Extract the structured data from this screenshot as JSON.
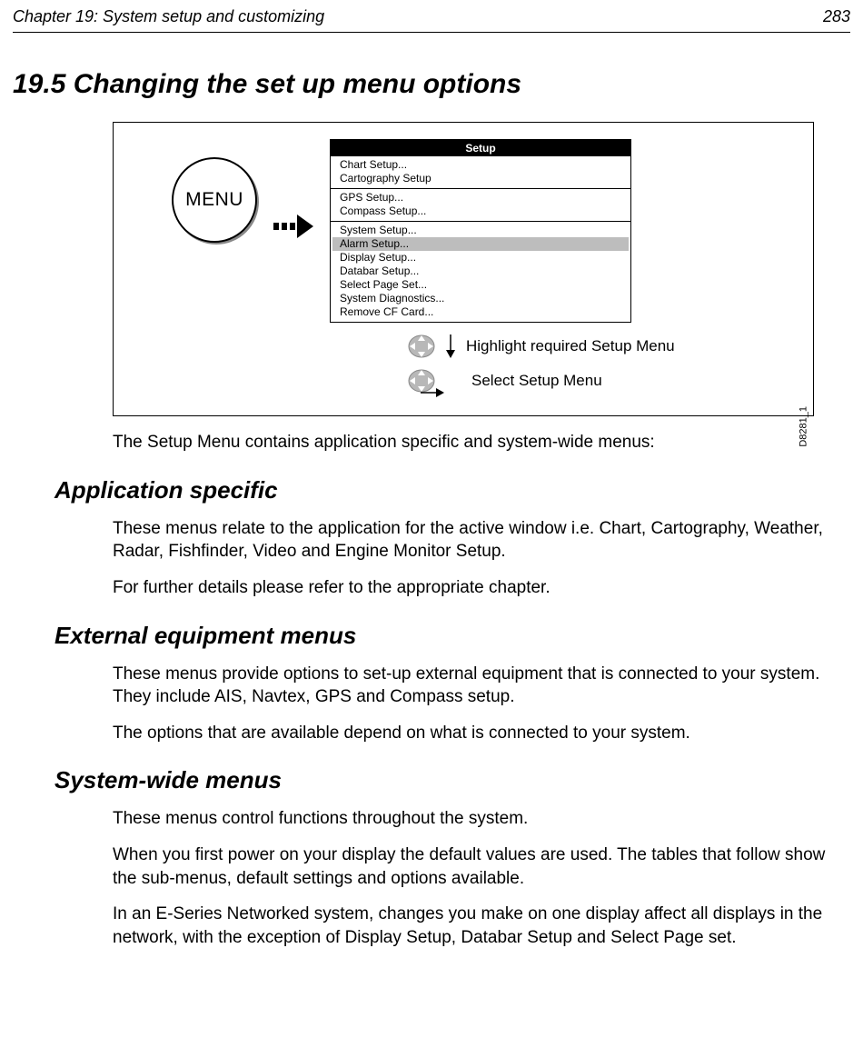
{
  "header": {
    "chapter": "Chapter 19: System setup and customizing",
    "page": "283"
  },
  "section_title": "19.5 Changing the set up menu options",
  "figure": {
    "menu_button": "MENU",
    "setup_title": "Setup",
    "groups": [
      [
        "Chart Setup...",
        "Cartography Setup"
      ],
      [
        "GPS Setup...",
        "Compass Setup..."
      ],
      [
        "System Setup...",
        "Alarm Setup...",
        "Display Setup...",
        "Databar Setup...",
        "Select Page Set...",
        "System Diagnostics...",
        "Remove CF Card..."
      ]
    ],
    "highlight": "Alarm Setup...",
    "hint1": "Highlight required Setup Menu",
    "hint2": "Select Setup Menu",
    "fig_id": "D8281_1"
  },
  "intro": "The Setup Menu contains application specific and system-wide menus:",
  "app_heading": "Application specific",
  "app_p1": "These menus relate to the application for the active window i.e. Chart, Cartography, Weather, Radar, Fishfinder, Video and Engine Monitor Setup.",
  "app_p2": "For further details please refer to the appropriate chapter.",
  "ext_heading": "External equipment menus",
  "ext_p1": "These menus provide options to set-up external equipment that is connected to your system. They include AIS, Navtex, GPS and Compass setup.",
  "ext_p2": "The options that are available depend on what is connected to your system.",
  "sys_heading": "System-wide menus",
  "sys_p1": "These menus control functions throughout the system.",
  "sys_p2": "When you first power on your display the default values are used. The tables that follow show the sub-menus, default settings and options available.",
  "sys_p3": "In an E-Series Networked system, changes you make on one display affect all displays in the network, with the exception of Display Setup, Databar Setup and Select Page set."
}
